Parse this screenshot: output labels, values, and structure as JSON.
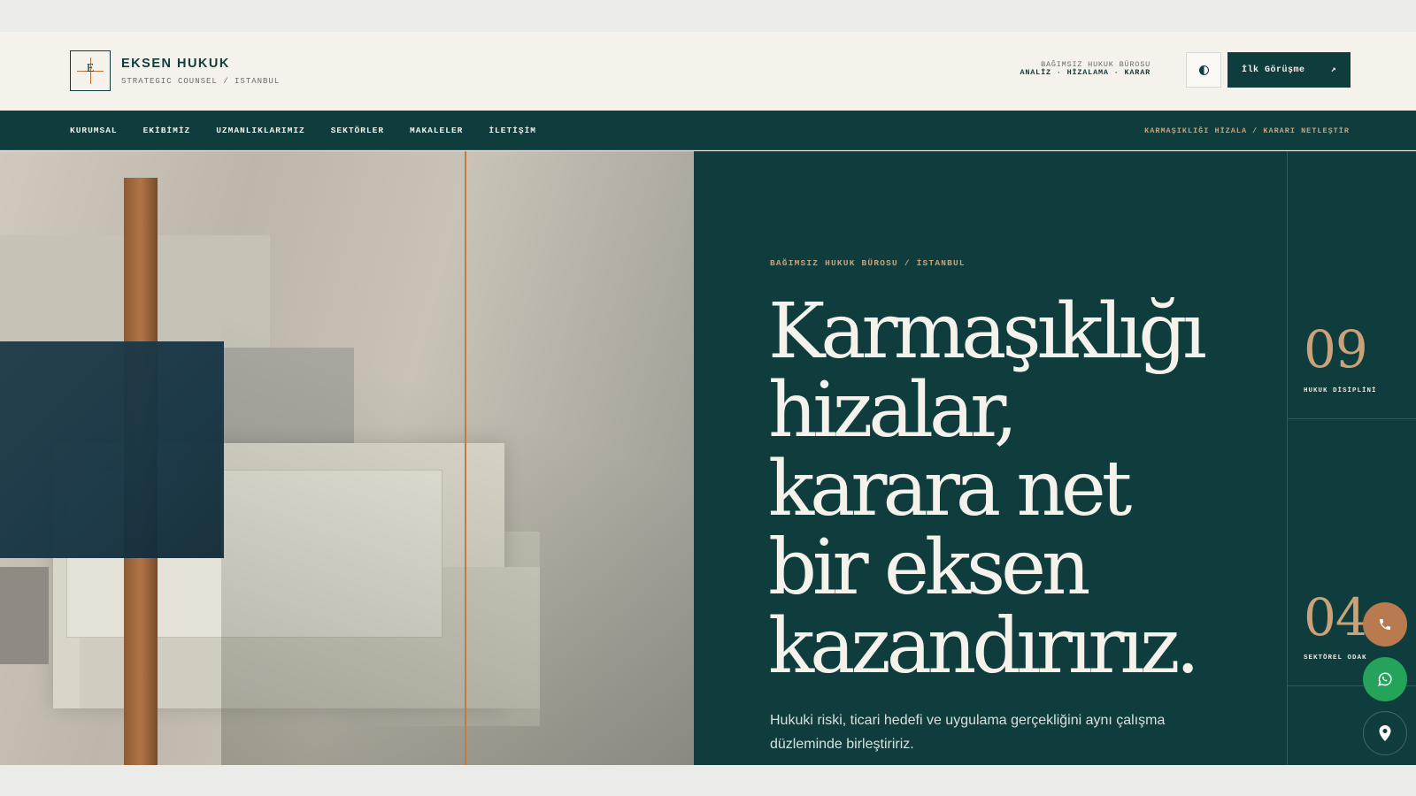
{
  "header": {
    "brand_mark": "E",
    "brand_name": "EKSEN HUKUK",
    "brand_tagline": "STRATEGIC COUNSEL / ISTANBUL",
    "meta_line1": "BAĞIMSIZ HUKUK BÜROSU",
    "meta_line2": "ANALİZ · HİZALAMA · KARAR",
    "theme_toggle_icon": "half-circle-icon",
    "cta_label": "İlk Görüşme",
    "cta_arrow": "↗"
  },
  "nav": {
    "items": [
      {
        "label": "KURUMSAL"
      },
      {
        "label": "EKİBİMİZ"
      },
      {
        "label": "UZMANLIKLARIMIZ"
      },
      {
        "label": "SEKTÖRLER"
      },
      {
        "label": "MAKALELER"
      },
      {
        "label": "İLETİŞİM"
      }
    ],
    "tagline": "KARMAŞIKLIĞI HİZALA / KARARI NETLEŞTİR"
  },
  "hero": {
    "eyebrow": "BAĞIMSIZ HUKUK BÜROSU / İSTANBUL",
    "headline_lines": [
      "Karmaşıklığı",
      "hizalar,",
      "karara net",
      "bir eksen",
      "kazandırırız."
    ],
    "description": "Hukuki riski, ticari hedefi ve uygulama gerçekliğini aynı çalışma düzleminde birleştiririz."
  },
  "stats": [
    {
      "number": "09",
      "label": "HUKUK DİSİPLİNİ"
    },
    {
      "number": "04",
      "label": "SEKTÖREL ODAK"
    }
  ],
  "floating_actions": [
    {
      "name": "phone-icon",
      "color": "#b87a4e"
    },
    {
      "name": "whatsapp-icon",
      "color": "#25a35a"
    },
    {
      "name": "map-pin-icon",
      "color": "#0f3d3d"
    }
  ],
  "colors": {
    "brand_dark": "#0f3d3d",
    "accent_copper": "#c9a27a",
    "background": "#f5f1eb"
  }
}
